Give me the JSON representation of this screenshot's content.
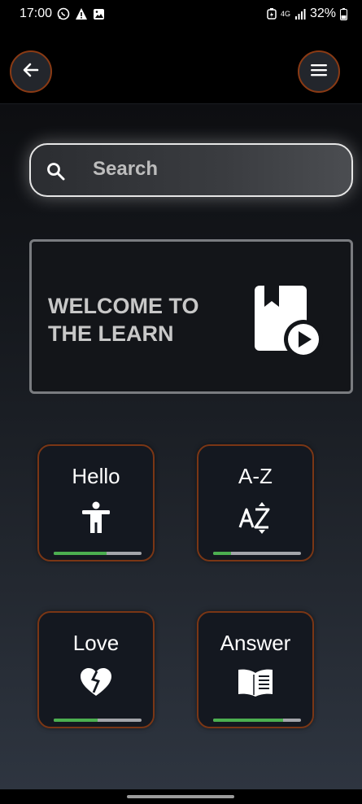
{
  "status_bar": {
    "time": "17:00",
    "network": "4G",
    "battery": "32%",
    "icons": [
      "whatsapp-icon",
      "warning-icon",
      "gallery-icon",
      "battery-saver-icon",
      "signal-icon",
      "battery-icon"
    ]
  },
  "topbar": {
    "back_icon": "arrow-left-icon",
    "menu_icon": "hamburger-menu-icon",
    "accent_border": "#8a3a14"
  },
  "search": {
    "placeholder": "Search",
    "icon": "search-icon"
  },
  "welcome": {
    "title": "WELCOME TO\nTHE LEARN",
    "icon": "bookmark-book-play-icon"
  },
  "cards": [
    {
      "title": "Hello",
      "icon": "person-standing-icon",
      "progress": 0.6
    },
    {
      "title": "A-Z",
      "icon": "sort-az-icon",
      "progress": 0.2
    },
    {
      "title": "Love",
      "icon": "broken-heart-icon",
      "progress": 0.5
    },
    {
      "title": "Answer",
      "icon": "open-book-icon",
      "progress": 0.8
    }
  ],
  "colors": {
    "progress_fill": "#4caf50",
    "progress_track": "#a3a5aa",
    "card_border": "#7a3615"
  }
}
